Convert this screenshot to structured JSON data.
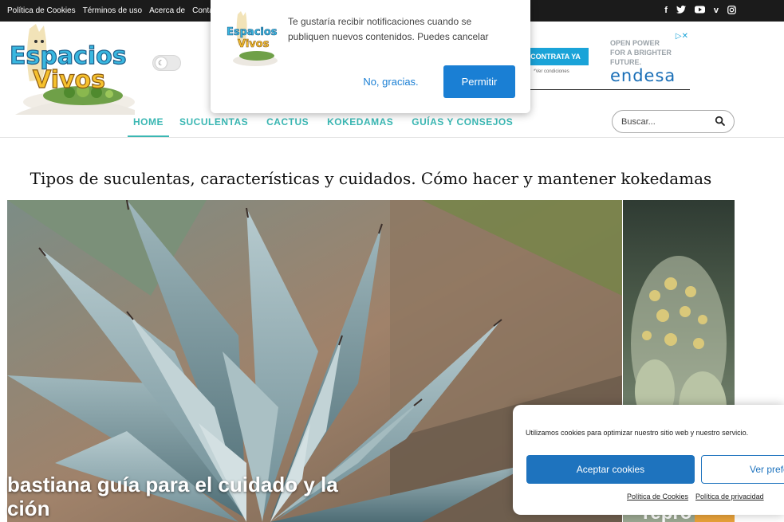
{
  "topbar": {
    "links": [
      "Política de Cookies",
      "Términos de uso",
      "Acerca de",
      "Contácta"
    ],
    "social_icons": [
      "facebook-icon",
      "twitter-icon",
      "youtube-icon",
      "vimeo-icon",
      "instagram-icon"
    ]
  },
  "logo": {
    "line1": "Espacios",
    "line2": "Vivos"
  },
  "ad": {
    "cta": "CONTRATA YA",
    "conditions": "*Ver condiciones",
    "slogan": "OPEN POWER\nFOR A BRIGHTER\nFUTURE.",
    "brand": "endesa",
    "adchoices": "▷✕"
  },
  "nav": {
    "items": [
      "HOME",
      "SUCULENTAS",
      "CACTUS",
      "KOKEDAMAS",
      "GUÍAS Y CONSEJOS"
    ],
    "active_index": 0
  },
  "search": {
    "placeholder": "Buscar..."
  },
  "tagline": "Tipos de suculentas, características y cuidados. Cómo hacer y mantener kokedamas",
  "hero": {
    "title_line1": "bastiana guía para el cuidado y la",
    "title_line2": "ción",
    "side_title": "repro"
  },
  "notification": {
    "message": "Te gustaría recibir notificaciones cuando se publiquen nuevos contenidos. Puedes cancelar",
    "decline": "No, gracias.",
    "accept": "Permitir"
  },
  "cookie": {
    "text": "Utilizamos cookies para optimizar nuestro sitio web y nuestro servicio.",
    "accept": "Aceptar cookies",
    "preferences": "Ver preferencias",
    "link_cookies": "Política de Cookies",
    "link_privacy": "Política de privacidad"
  },
  "colors": {
    "accent": "#3ab7b3",
    "topbar": "#1b1b1b",
    "primary_button": "#1a7fd4",
    "cookie_button": "#1e73be"
  }
}
